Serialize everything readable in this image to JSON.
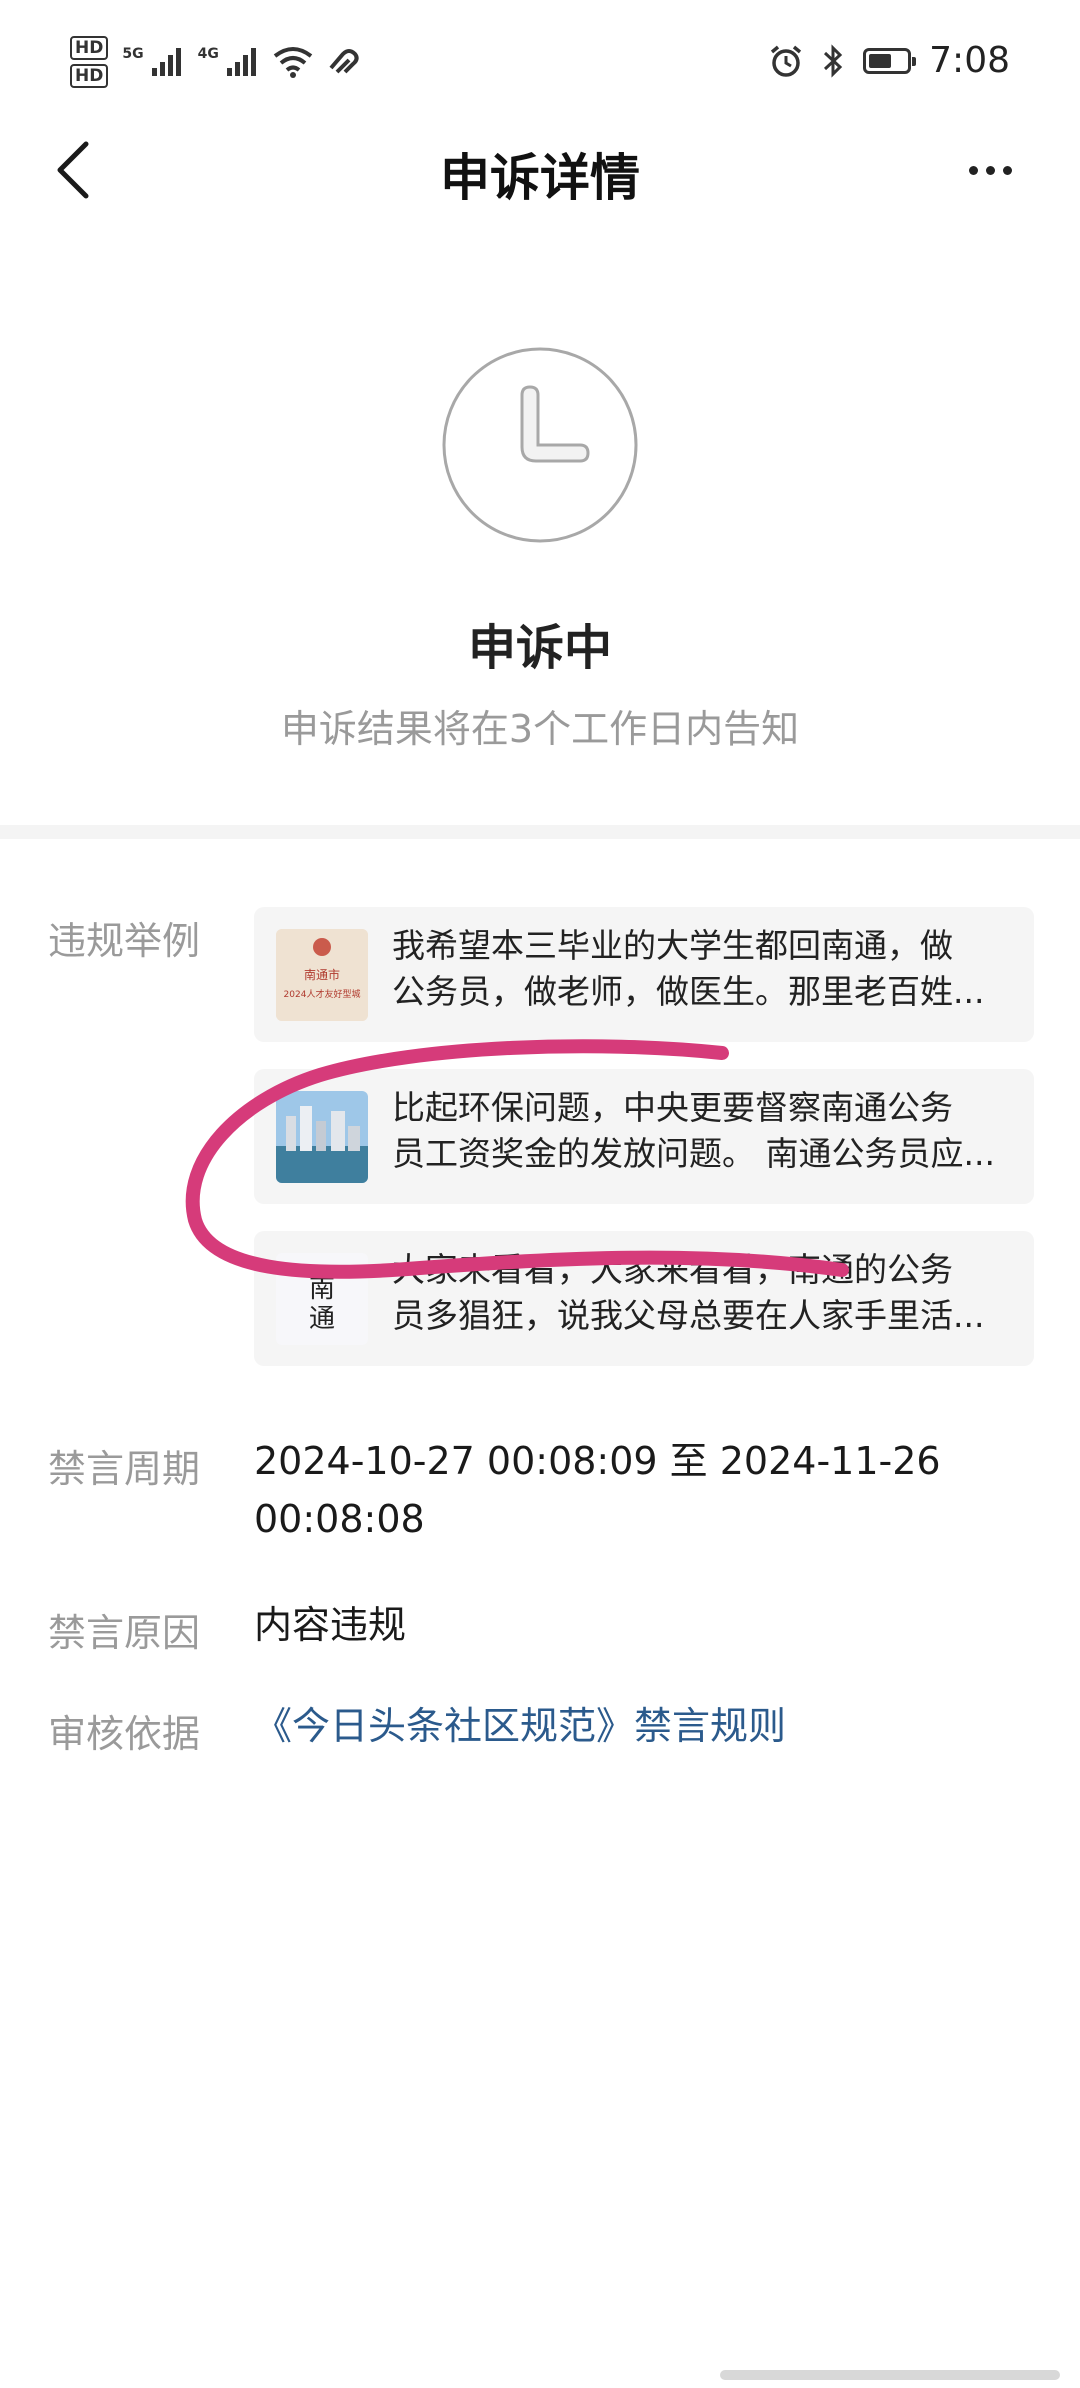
{
  "status_bar": {
    "time": "7:08",
    "sim1": "HD",
    "sim2": "HD",
    "network1": "5G",
    "network2": "4G",
    "icons": [
      "wifi-icon",
      "alarm-icon",
      "bluetooth-icon",
      "battery-icon"
    ],
    "battery_level": 0.6
  },
  "nav": {
    "title": "申诉详情",
    "back_icon": "chevron-left-icon",
    "more_icon": "more-icon"
  },
  "status": {
    "icon": "clock-icon",
    "title": "申诉中",
    "subtitle": "申诉结果将在3个工作日内告知"
  },
  "details": {
    "examples_label": "违规举例",
    "examples": [
      {
        "line1": "我希望本三毕业的大学生都回南通，做",
        "line2": "公务员，做老师，做医生。那里老百姓...",
        "thumb_text1": "南通市",
        "thumb_text2": "2024人才友好型城"
      },
      {
        "line1": "比起环保问题，中央更要督察南通公务",
        "line2": "员工资奖金的发放问题。 南通公务员应..."
      },
      {
        "line1": "大家来看看，大家来看看，南通的公务",
        "line2": "员多猖狂，说我父母总要在人家手里活...",
        "thumb_text1": "南",
        "thumb_text2": "通"
      }
    ],
    "period_label": "禁言周期",
    "period_line1": "2024-10-27 00:08:09 至 2024-11-26",
    "period_line2": "00:08:08",
    "reason_label": "禁言原因",
    "reason_value": "内容违规",
    "basis_label": "审核依据",
    "basis_value": "《今日头条社区规范》禁言规则"
  },
  "colors": {
    "link": "#2b5a8c",
    "scribble": "#d63b7a",
    "muted": "#9a9a9a"
  }
}
